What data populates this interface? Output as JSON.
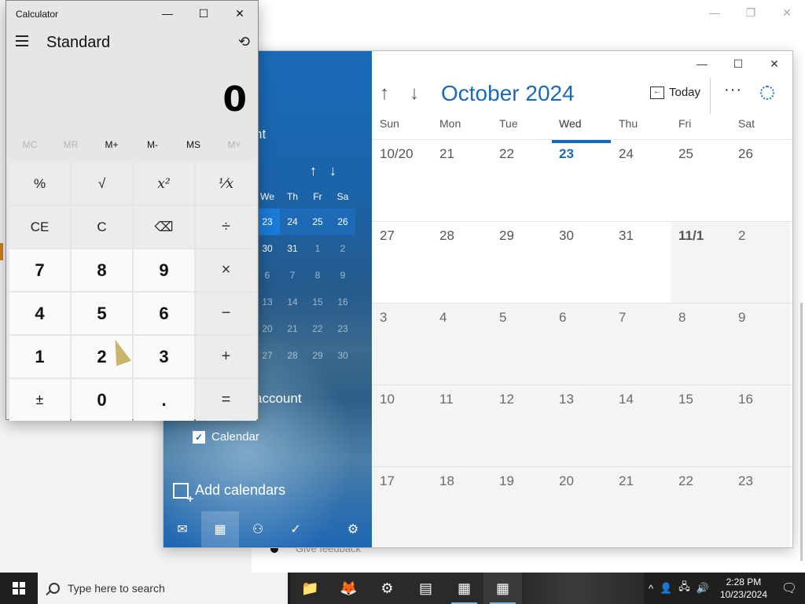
{
  "background_window": {
    "caption": {
      "minimize": "—",
      "restore": "❐",
      "close": "✕"
    },
    "feedback_text": "Give feedback"
  },
  "calendar": {
    "caption": {
      "minimize": "—",
      "maximize": "☐",
      "close": "✕"
    },
    "sidebar": {
      "title_fragment": "nt",
      "mini_nav": {
        "up": "↑",
        "down": "↓"
      },
      "mini_headers": [
        "We",
        "Th",
        "Fr",
        "Sa"
      ],
      "mini_rows": [
        [
          "23",
          "24",
          "25",
          "26"
        ],
        [
          "30",
          "31",
          "1",
          "2"
        ],
        [
          "6",
          "7",
          "8",
          "9"
        ],
        [
          "13",
          "14",
          "15",
          "16"
        ],
        [
          "20",
          "21",
          "22",
          "23"
        ],
        [
          "27",
          "28",
          "29",
          "30"
        ]
      ],
      "account_fragment": "account",
      "calendar_checkbox_label": "Calendar",
      "add_calendars": "Add calendars",
      "bottom_nav": {
        "mail": "✉",
        "calendar": "▦",
        "people": "⚇",
        "todo": "✓",
        "settings": "⚙"
      }
    },
    "toolbar": {
      "up_arrow": "↑",
      "down_arrow": "↓",
      "month_title": "October 2024",
      "today_label": "Today",
      "today_icon": "←",
      "more": "···"
    },
    "weekdays": [
      "Sun",
      "Mon",
      "Tue",
      "Wed",
      "Thu",
      "Fri",
      "Sat"
    ],
    "weeks": [
      [
        "10/20",
        "21",
        "22",
        "23",
        "24",
        "25",
        "26"
      ],
      [
        "27",
        "28",
        "29",
        "30",
        "31",
        "11/1",
        "2"
      ],
      [
        "3",
        "4",
        "5",
        "6",
        "7",
        "8",
        "9"
      ],
      [
        "10",
        "11",
        "12",
        "13",
        "14",
        "15",
        "16"
      ],
      [
        "17",
        "18",
        "19",
        "20",
        "21",
        "22",
        "23"
      ]
    ]
  },
  "calculator": {
    "title": "Calculator",
    "caption": {
      "minimize": "—",
      "maximize": "☐",
      "close": "✕"
    },
    "mode": "Standard",
    "history_icon": "⟲",
    "display": "0",
    "memory": [
      "MC",
      "MR",
      "M+",
      "M-",
      "MS",
      "M˅"
    ],
    "keys": [
      "%",
      "√",
      "x²",
      "⅟x",
      "CE",
      "C",
      "⌫",
      "÷",
      "7",
      "8",
      "9",
      "×",
      "4",
      "5",
      "6",
      "−",
      "1",
      "2",
      "3",
      "+",
      "±",
      "0",
      ".",
      "="
    ]
  },
  "taskbar": {
    "search_placeholder": "Type here to search",
    "apps": {
      "explorer": "📁",
      "firefox": "🦊",
      "settings": "⚙",
      "news": "▤",
      "calendar": "▦",
      "calculator": "▦"
    },
    "tray": {
      "chevron": "^",
      "people": "👤",
      "network": "🖧",
      "volume": "🔊"
    },
    "time": "2:28 PM",
    "date": "10/23/2024",
    "notification": "🗨"
  }
}
